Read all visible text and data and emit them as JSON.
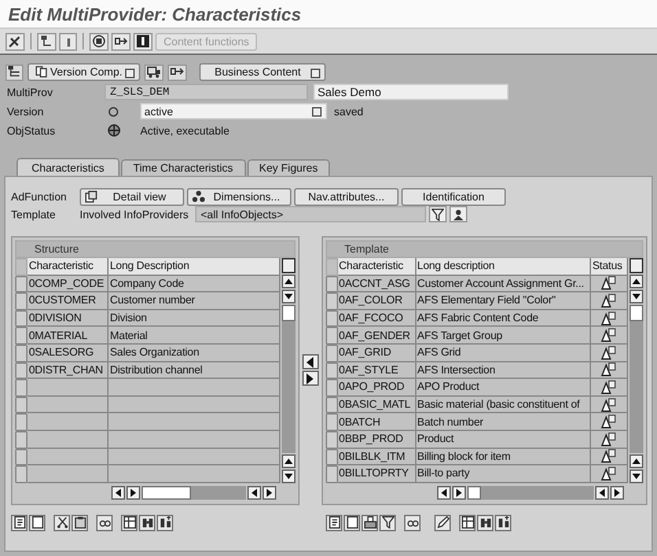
{
  "window": {
    "title": "Edit MultiProvider: Characteristics"
  },
  "toolbar": {
    "buttons": [
      {
        "label": "Content functions",
        "disabled": true
      }
    ]
  },
  "object_toolbar": {
    "version_comp": "Version Comp.",
    "business_content": "Business Content"
  },
  "multiprov": {
    "label": "MultiProv",
    "value": "Z_SLS_DEM",
    "description": "Sales Demo"
  },
  "version": {
    "label": "Version",
    "value": "active",
    "status": "saved"
  },
  "objstatus": {
    "label": "ObjStatus",
    "value": "Active, executable"
  },
  "tabs": [
    {
      "label": "Characteristics",
      "selected": true
    },
    {
      "label": "Time Characteristics",
      "selected": false
    },
    {
      "label": "Key Figures",
      "selected": false
    }
  ],
  "adfunction": {
    "label": "AdFunction",
    "buttons": [
      "Detail view",
      "Dimensions...",
      "Nav.attributes...",
      "Identification"
    ]
  },
  "template_filter": {
    "label": "Template",
    "text": "Involved InfoProviders",
    "value": "<all InfoObjects>"
  },
  "structure": {
    "title": "Structure",
    "columns": [
      "Characteristic",
      "Long Description"
    ],
    "rows": [
      {
        "characteristic": "0COMP_CODE",
        "description": "Company Code"
      },
      {
        "characteristic": "0CUSTOMER",
        "description": "Customer number"
      },
      {
        "characteristic": "0DIVISION",
        "description": "Division"
      },
      {
        "characteristic": "0MATERIAL",
        "description": "Material"
      },
      {
        "characteristic": "0SALESORG",
        "description": "Sales Organization"
      },
      {
        "characteristic": "0DISTR_CHAN",
        "description": "Distribution channel"
      }
    ]
  },
  "template": {
    "title": "Template",
    "columns": [
      "Characteristic",
      "Long description",
      "Status"
    ],
    "rows": [
      {
        "characteristic": "0ACCNT_ASG",
        "description": "Customer Account Assignment Gr..."
      },
      {
        "characteristic": "0AF_COLOR",
        "description": "AFS Elementary Field \"Color\""
      },
      {
        "characteristic": "0AF_FCOCO",
        "description": "AFS Fabric Content Code"
      },
      {
        "characteristic": "0AF_GENDER",
        "description": "AFS Target Group"
      },
      {
        "characteristic": "0AF_GRID",
        "description": "AFS Grid"
      },
      {
        "characteristic": "0AF_STYLE",
        "description": "AFS Intersection"
      },
      {
        "characteristic": "0APO_PROD",
        "description": "APO Product"
      },
      {
        "characteristic": "0BASIC_MATL",
        "description": "Basic material (basic constituent of"
      },
      {
        "characteristic": "0BATCH",
        "description": "Batch number"
      },
      {
        "characteristic": "0BBP_PROD",
        "description": "Product"
      },
      {
        "characteristic": "0BILBLK_ITM",
        "description": "Billing block for item"
      },
      {
        "characteristic": "0BILLTOPRTY",
        "description": "Bill-to party"
      }
    ]
  }
}
